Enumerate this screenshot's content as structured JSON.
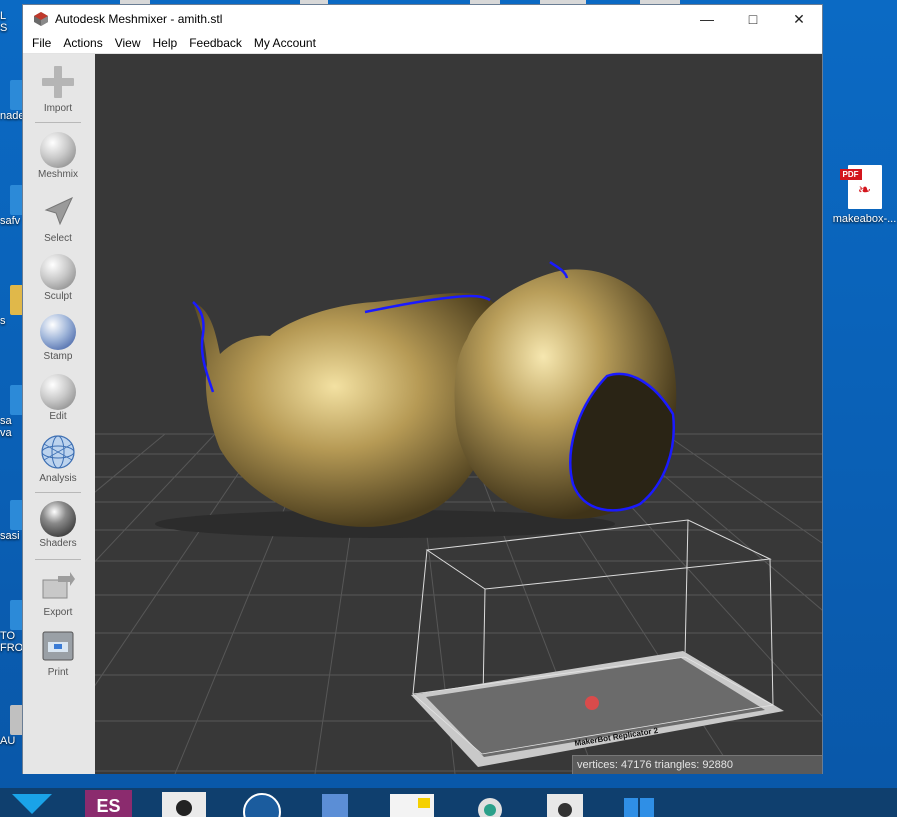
{
  "window": {
    "title": "Autodesk Meshmixer - amith.stl",
    "controls": {
      "minimize": "—",
      "maximize": "□",
      "close": "✕"
    }
  },
  "menu": [
    "File",
    "Actions",
    "View",
    "Help",
    "Feedback",
    "My Account"
  ],
  "toolbar": {
    "tools": [
      {
        "label": "Import",
        "icon": "plus-icon"
      },
      {
        "label": "Meshmix",
        "icon": "bunny-sphere-icon"
      },
      {
        "label": "Select",
        "icon": "arrow-cursor-icon"
      },
      {
        "label": "Sculpt",
        "icon": "brush-icon"
      },
      {
        "label": "Stamp",
        "icon": "fleur-stamp-icon"
      },
      {
        "label": "Edit",
        "icon": "edit-mesh-icon"
      },
      {
        "label": "Analysis",
        "icon": "wireframe-sphere-icon"
      },
      {
        "label": "Shaders",
        "icon": "shader-sphere-icon"
      },
      {
        "label": "Export",
        "icon": "export-icon"
      },
      {
        "label": "Print",
        "icon": "printer-icon"
      }
    ]
  },
  "viewport": {
    "build_plate_label": "MakerBot Replicator 2",
    "status": "vertices: 47176 triangles: 92880",
    "colors": {
      "background": "#383838",
      "mesh": "#a08a4a",
      "boundary": "#1a1aff",
      "plate": "#cfcfcf"
    }
  },
  "desktop": {
    "pdf_icon": {
      "badge": "PDF",
      "label": "makeabox-..."
    },
    "left_labels": [
      "L",
      "S",
      "nade",
      "safv",
      "s",
      "sa",
      "va",
      "sasi",
      "TO",
      "FRO",
      "AU"
    ]
  },
  "taskbar": {
    "es_label": "ES"
  }
}
